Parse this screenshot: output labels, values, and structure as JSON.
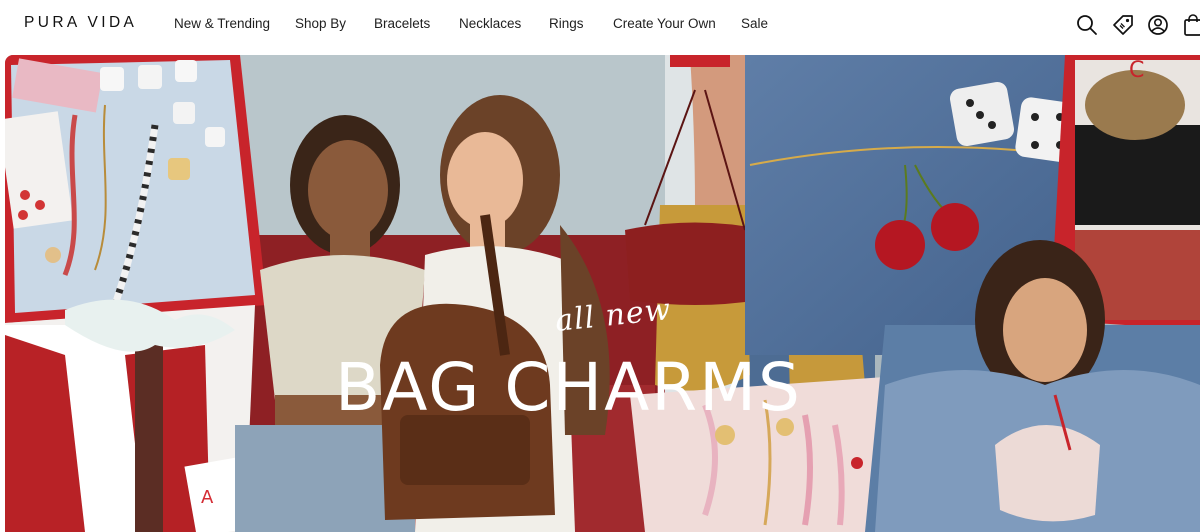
{
  "brand": {
    "logo_text": "PURA VIDA"
  },
  "nav": {
    "items": [
      {
        "label": "New & Trending"
      },
      {
        "label": "Shop By"
      },
      {
        "label": "Bracelets"
      },
      {
        "label": "Necklaces"
      },
      {
        "label": "Rings"
      },
      {
        "label": "Create Your Own"
      },
      {
        "label": "Sale"
      }
    ]
  },
  "header_icons": [
    "search-icon",
    "rewards-tag-icon",
    "account-icon",
    "cart-bag-icon"
  ],
  "hero": {
    "script_text": "all new",
    "headline": "BAG CHARMS"
  },
  "colors": {
    "background": "#ffffff",
    "nav_text": "#1f1f1f",
    "hero_text": "#ffffff",
    "card_red": "#c8242b",
    "denim": "#4e6f9a"
  }
}
